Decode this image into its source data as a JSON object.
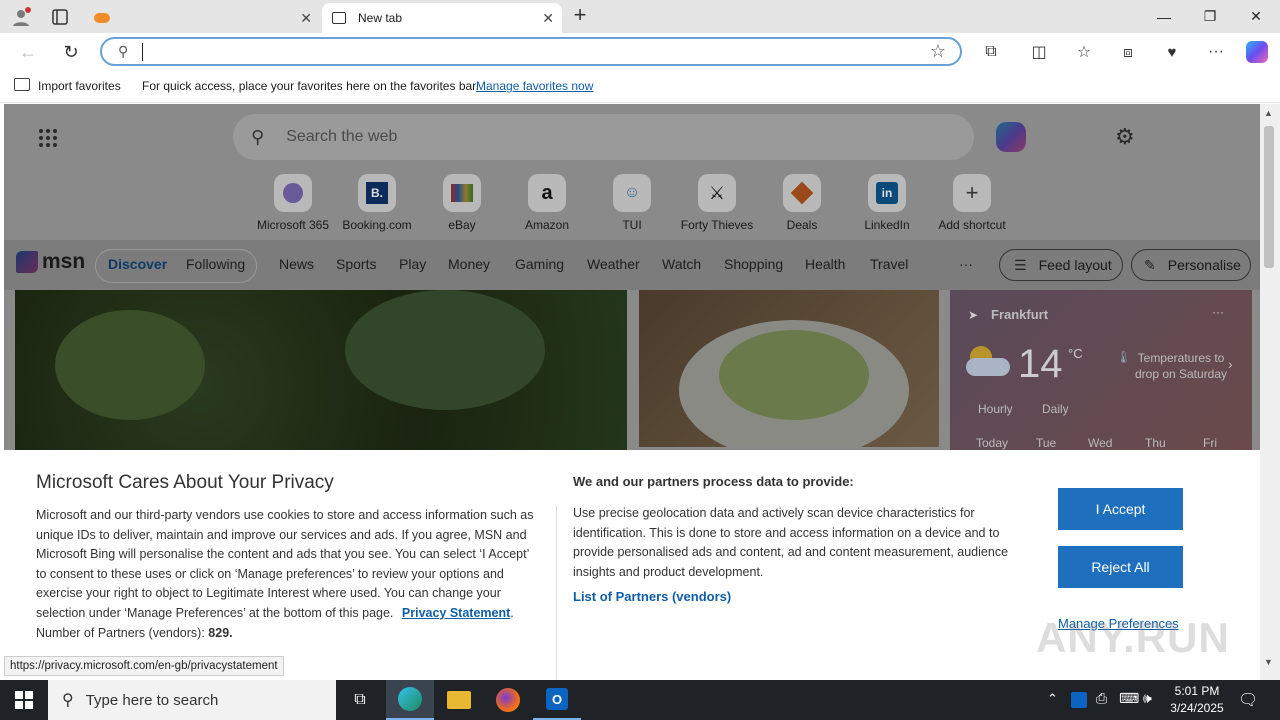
{
  "browser": {
    "tabs": [
      {
        "label": "",
        "active": false
      },
      {
        "label": "New tab",
        "active": true
      }
    ],
    "address": {
      "value": "",
      "placeholder": ""
    },
    "favorites_bar": {
      "import_label": "Import favorites",
      "hint": "For quick access, place your favorites here on the favorites bar.",
      "manage_link": "Manage favorites now"
    }
  },
  "newtab": {
    "search_placeholder": "Search the web",
    "shortcuts": [
      {
        "label": "Microsoft 365"
      },
      {
        "label": "Booking.com"
      },
      {
        "label": "eBay"
      },
      {
        "label": "Amazon"
      },
      {
        "label": "TUI"
      },
      {
        "label": "Forty Thieves"
      },
      {
        "label": "Deals"
      },
      {
        "label": "LinkedIn"
      },
      {
        "label": "Add shortcut"
      }
    ],
    "msn": {
      "logo": "msn",
      "tabs": [
        "Discover",
        "Following"
      ],
      "nav": [
        "News",
        "Sports",
        "Play",
        "Money",
        "Gaming",
        "Weather",
        "Watch",
        "Shopping",
        "Health",
        "Travel"
      ],
      "more": "···",
      "feed_layout": "Feed layout",
      "personalise": "Personalise"
    },
    "weather": {
      "city": "Frankfurt",
      "temp": "14",
      "unit": "°C",
      "note": "Temperatures to drop on Saturday",
      "tabs": [
        "Hourly",
        "Daily"
      ],
      "days": [
        "Today",
        "Tue",
        "Wed",
        "Thu",
        "Fri"
      ]
    }
  },
  "consent": {
    "title": "Microsoft Cares About Your Privacy",
    "body": "Microsoft and our third-party vendors use cookies to store and access information such as unique IDs to deliver, maintain and improve our services and ads. If you agree, MSN and Microsoft Bing will personalise the content and ads that you see. You can select ‘I Accept’ to consent to these uses or click on ‘Manage preferences’ to review your options and exercise your right to object to Legitimate Interest where used.  You can change your selection under ‘Manage Preferences’ at the bottom of this page.",
    "privacy_link": "Privacy Statement",
    "partners_count_label": "Number of Partners (vendors):",
    "partners_count": "829.",
    "right_title": "We and our partners process data to provide:",
    "right_body": "Use precise geolocation data and actively scan device characteristics for identification. This is done to store and access information on a device and to provide personalised ads and content, ad and content measurement, audience insights and product development.",
    "partners_link": "List of Partners (vendors)",
    "accept": "I Accept",
    "reject": "Reject All",
    "manage": "Manage Preferences"
  },
  "status_url": "https://privacy.microsoft.com/en-gb/privacystatement",
  "watermark": "ANY.RUN",
  "taskbar": {
    "search_placeholder": "Type here to search",
    "time": "5:01 PM",
    "date": "3/24/2025"
  },
  "colors": {
    "accent": "#1f6fbf",
    "link": "#0f5ea8",
    "taskbar": "#1f2227"
  }
}
